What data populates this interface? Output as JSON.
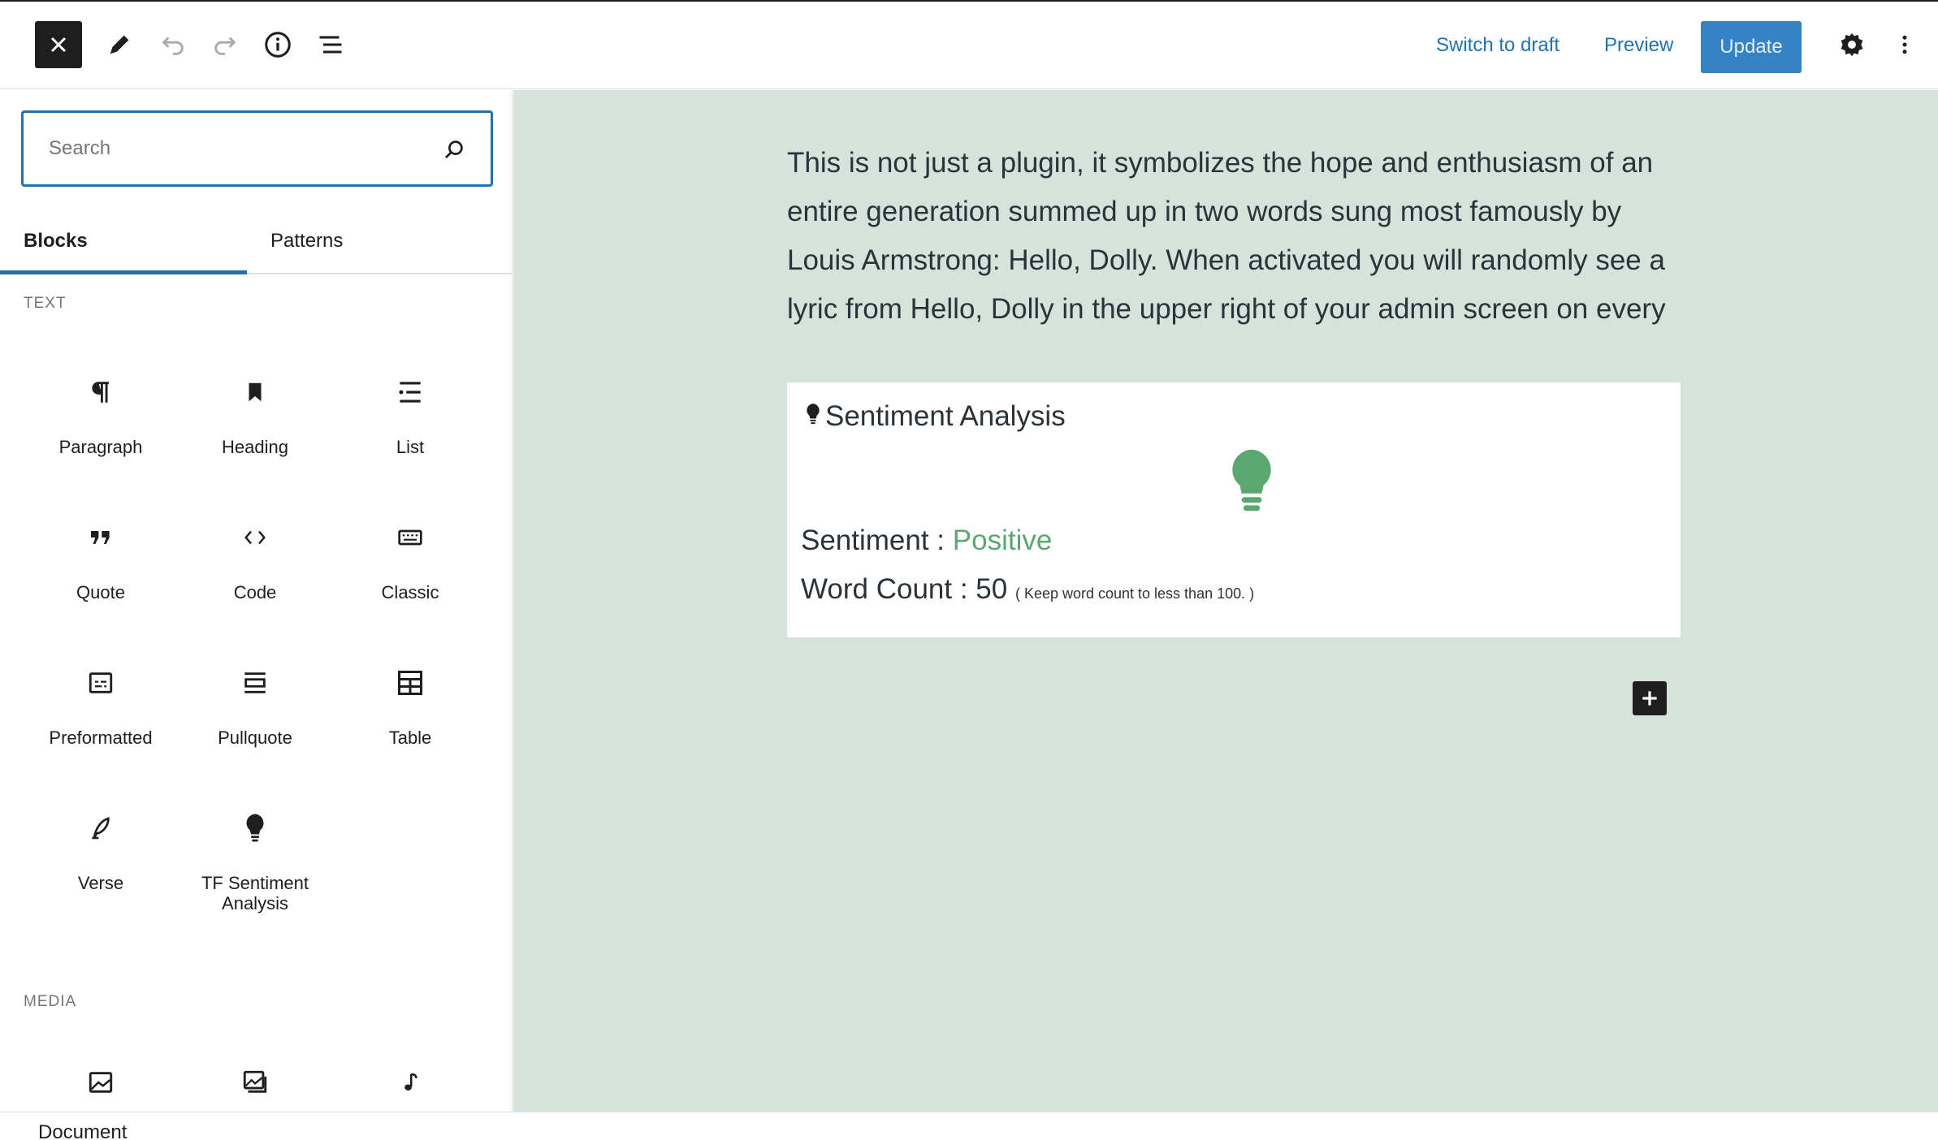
{
  "toolbar": {
    "close_icon": "close-icon",
    "switch_to_draft": "Switch to draft",
    "preview": "Preview",
    "update": "Update",
    "colors": {
      "link": "#2271b1",
      "update_bg": "#3582c4"
    }
  },
  "sidebar": {
    "search_placeholder": "Search",
    "tabs": [
      {
        "label": "Blocks",
        "active": true
      },
      {
        "label": "Patterns",
        "active": false
      }
    ],
    "categories": {
      "text": "TEXT",
      "media": "MEDIA"
    },
    "blocks": [
      {
        "label": "Paragraph",
        "icon": "paragraph-icon"
      },
      {
        "label": "Heading",
        "icon": "bookmark-icon"
      },
      {
        "label": "List",
        "icon": "list-icon"
      },
      {
        "label": "Quote",
        "icon": "quote-icon"
      },
      {
        "label": "Code",
        "icon": "code-icon"
      },
      {
        "label": "Classic",
        "icon": "keyboard-icon"
      },
      {
        "label": "Preformatted",
        "icon": "preformatted-icon"
      },
      {
        "label": "Pullquote",
        "icon": "pullquote-icon"
      },
      {
        "label": "Table",
        "icon": "table-icon"
      },
      {
        "label": "Verse",
        "icon": "feather-icon"
      },
      {
        "label": "TF Sentiment Analysis",
        "icon": "lightbulb-icon"
      }
    ],
    "media_blocks": [
      {
        "icon": "image-icon"
      },
      {
        "icon": "gallery-icon"
      },
      {
        "icon": "audio-icon"
      }
    ]
  },
  "editor": {
    "paragraph": "This is not just a plugin, it symbolizes the hope and enthusiasm of an entire generation summed up in two words sung most famously by Louis Armstrong: Hello, Dolly. When activated you will randomly see a lyric from Hello, Dolly in the upper right of your admin screen on every",
    "sentiment_block": {
      "title": "Sentiment Analysis",
      "sentiment_label": "Sentiment : ",
      "sentiment_value": "Positive",
      "word_count_label": "Word Count : 50",
      "word_count_note": "( Keep word count to less than 100. )",
      "accent_color": "#5aa870"
    }
  },
  "statusbar": {
    "breadcrumb": "Document"
  }
}
